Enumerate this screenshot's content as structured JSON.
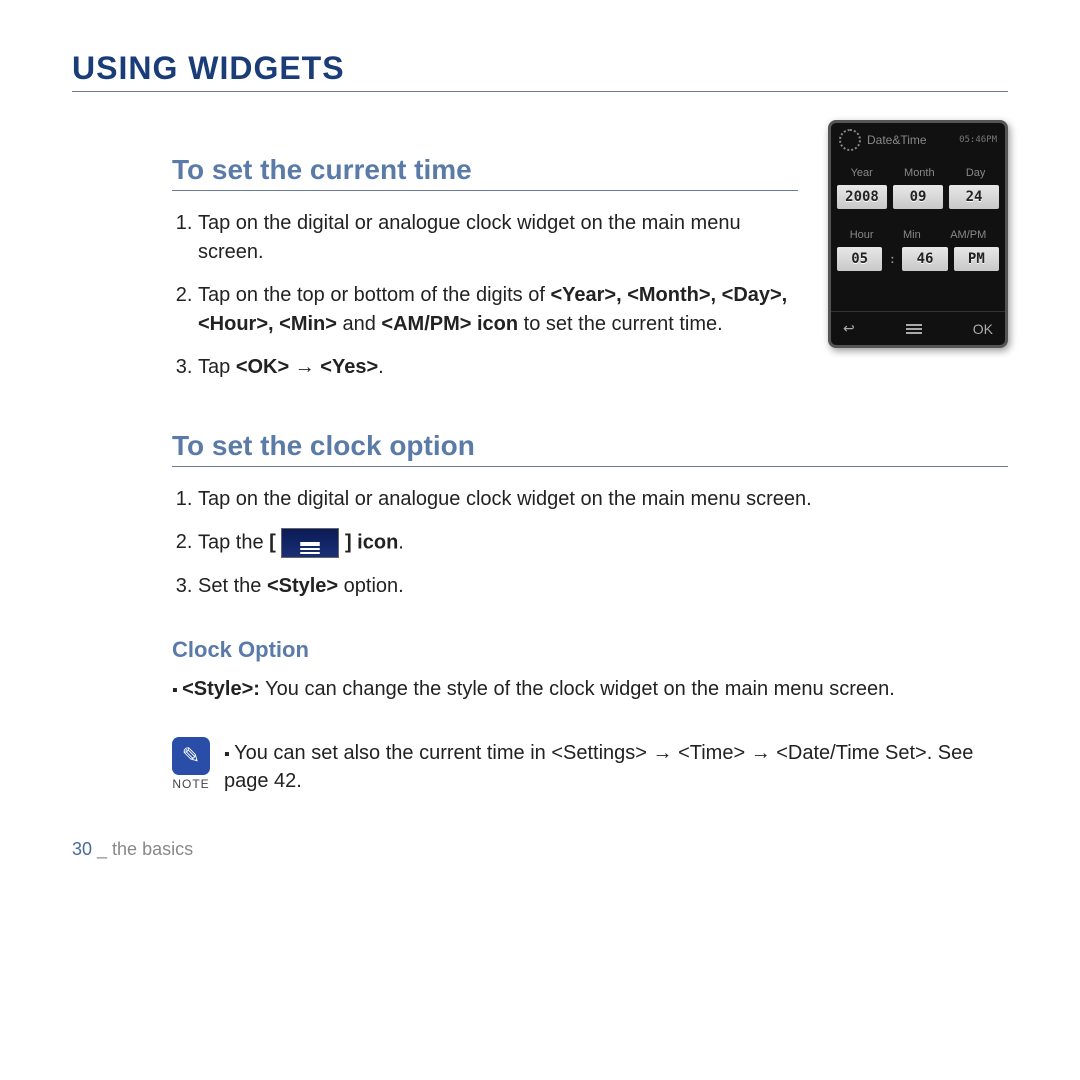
{
  "title": "USING WIDGETS",
  "section1": {
    "heading": "To set the current time",
    "step1": "Tap on the digital or analogue clock widget on the main menu screen.",
    "step2a": "Tap on the top or bottom of the digits of ",
    "step2b": "<Year>, <Month>, <Day>, <Hour>, <Min>",
    "step2c": " and ",
    "step2d": "<AM/PM> icon",
    "step2e": " to set the current time.",
    "step3a": "Tap ",
    "step3b": "<OK> → <Yes>",
    "step3c": "."
  },
  "section2": {
    "heading": "To set the clock option",
    "step1": "Tap on the digital or analogue clock widget on the main menu screen.",
    "step2a": "Tap the ",
    "step2b": "[ ",
    "step2c": " ] icon",
    "step2d": ".",
    "step3a": "Set the ",
    "step3b": "<Style>",
    "step3c": " option."
  },
  "clockOption": {
    "heading": "Clock Option",
    "body_label": "<Style>:",
    "body_text": " You can change the style of the clock widget on the main menu screen."
  },
  "note": {
    "label": "NOTE",
    "text": "You can set also the current time in <Settings> → <Time> → <Date/Time Set>. See page 42."
  },
  "footer": {
    "page": "30",
    "sep": " _ ",
    "section": "the basics"
  },
  "device": {
    "title": "Date&Time",
    "status": "05:46PM",
    "labels1": {
      "a": "Year",
      "b": "Month",
      "c": "Day"
    },
    "vals1": {
      "a": "2008",
      "b": "09",
      "c": "24"
    },
    "labels2": {
      "a": "Hour",
      "b": "Min",
      "c": "AM/PM"
    },
    "vals2": {
      "a": "05",
      "b": "46",
      "c": "PM"
    },
    "nav": {
      "back": "↩",
      "ok": "OK"
    }
  }
}
